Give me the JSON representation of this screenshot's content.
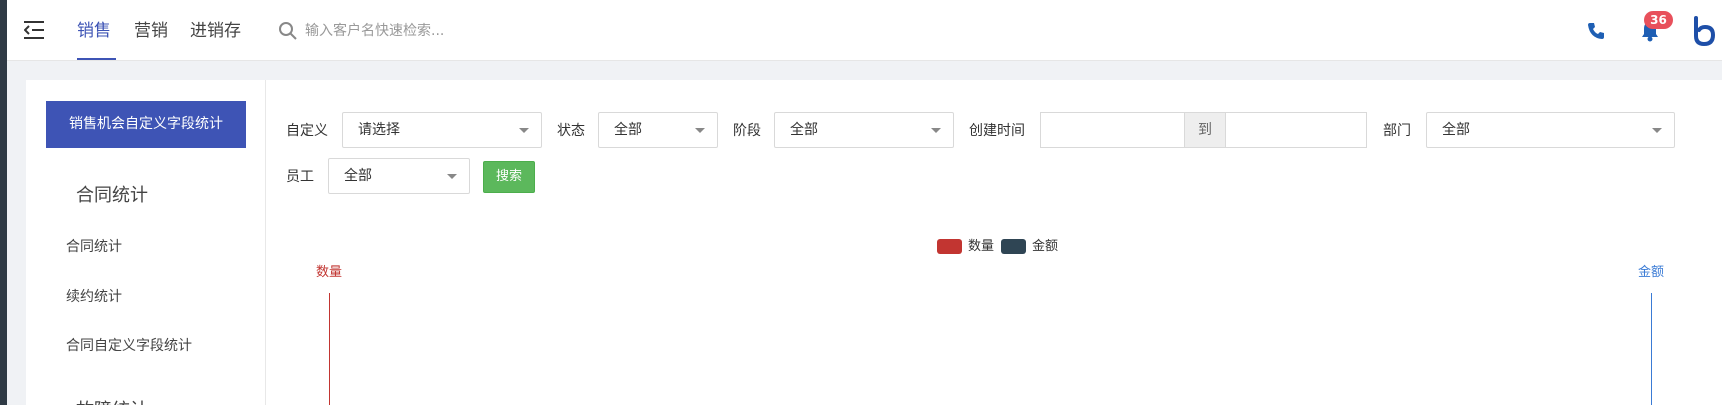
{
  "topnav": {
    "tabs": [
      {
        "label": "销售",
        "active": true
      },
      {
        "label": "营销",
        "active": false
      },
      {
        "label": "进销存",
        "active": false
      }
    ],
    "search_placeholder": "输入客户名快速检索...",
    "notification_count": "36",
    "icons": [
      "menu-toggle-icon",
      "search-icon",
      "phone-icon",
      "bell-icon",
      "logo"
    ]
  },
  "sidebar": {
    "active_item": "销售机会自定义字段统计",
    "groups": [
      {
        "title": "合同统计",
        "items": [
          "合同统计",
          "续约统计",
          "合同自定义字段统计"
        ]
      },
      {
        "title": "故障统计",
        "items": []
      }
    ]
  },
  "filters": {
    "custom": {
      "label": "自定义",
      "value": "请选择"
    },
    "status": {
      "label": "状态",
      "value": "全部"
    },
    "stage": {
      "label": "阶段",
      "value": "全部"
    },
    "created_time": {
      "label": "创建时间",
      "start": "",
      "separator": "到",
      "end": ""
    },
    "department": {
      "label": "部门",
      "value": "全部"
    },
    "employee": {
      "label": "员工",
      "value": "全部"
    },
    "search_button": "搜索"
  },
  "chart_data": {
    "type": "bar",
    "series": [
      {
        "name": "数量",
        "color": "#c23531",
        "values": []
      },
      {
        "name": "金额",
        "color": "#2f4554",
        "values": []
      }
    ],
    "yaxis_left": {
      "name": "数量",
      "color": "#c23531"
    },
    "yaxis_right": {
      "name": "金额",
      "color": "#3a7bd5"
    },
    "legend_position": "top-center"
  }
}
